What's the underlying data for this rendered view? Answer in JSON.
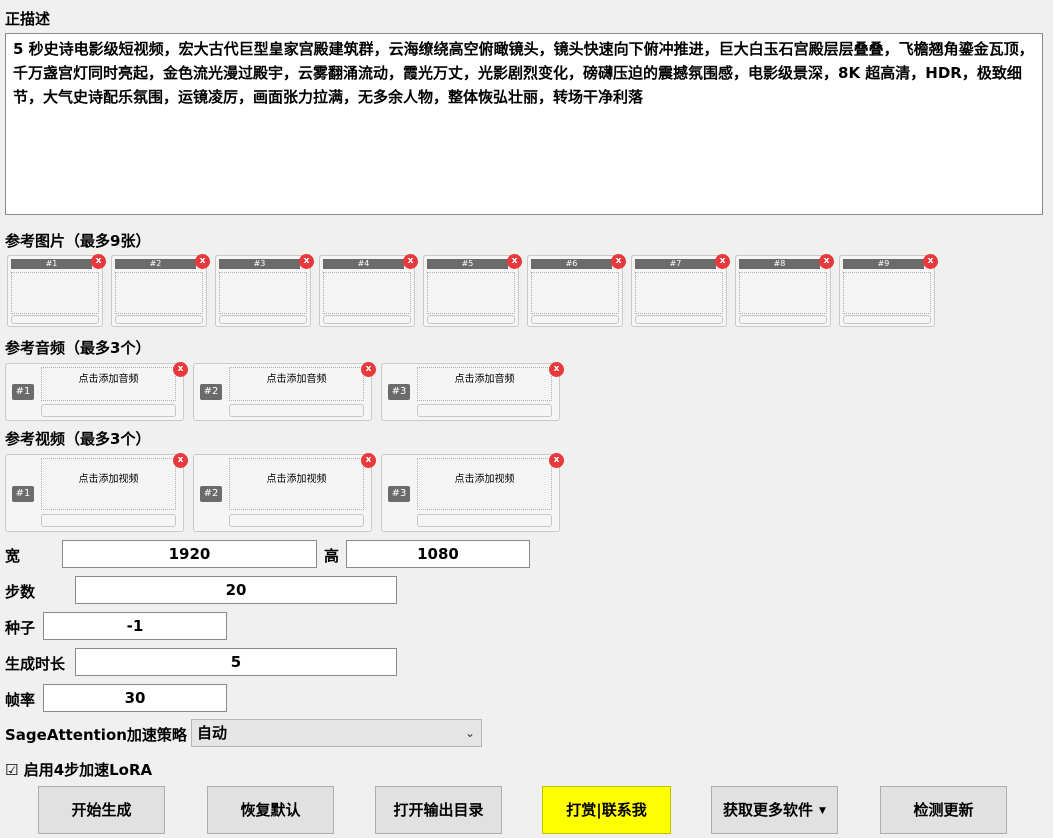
{
  "prompt": {
    "label": "正描述",
    "text": "5 秒史诗电影级短视频，宏大古代巨型皇家宫殿建筑群，云海缭绕高空俯瞰镜头，镜头快速向下俯冲推进，巨大白玉石宫殿层层叠叠，飞檐翘角鎏金瓦顶，千万盏宫灯同时亮起，金色流光漫过殿宇，云雾翻涌流动，霞光万丈，光影剧烈变化，磅礴压迫的震撼氛围感，电影级景深，8K 超高清，HDR，极致细节，大气史诗配乐氛围，运镜凌厉，画面张力拉满，无多余人物，整体恢弘壮丽，转场干净利落"
  },
  "images": {
    "label": "参考图片（最多9张）",
    "slots": [
      "#1",
      "#2",
      "#3",
      "#4",
      "#5",
      "#6",
      "#7",
      "#8",
      "#9"
    ],
    "remove_glyph": "x"
  },
  "audio": {
    "label": "参考音频（最多3个）",
    "slots": [
      {
        "index": "#1",
        "prompt": "点击添加音频"
      },
      {
        "index": "#2",
        "prompt": "点击添加音频"
      },
      {
        "index": "#3",
        "prompt": "点击添加音频"
      }
    ]
  },
  "video": {
    "label": "参考视频（最多3个）",
    "slots": [
      {
        "index": "#1",
        "prompt": "点击添加视频"
      },
      {
        "index": "#2",
        "prompt": "点击添加视频"
      },
      {
        "index": "#3",
        "prompt": "点击添加视频"
      }
    ]
  },
  "params": {
    "width_label": "宽",
    "width": "1920",
    "height_label": "高",
    "height": "1080",
    "steps_label": "步数",
    "steps": "20",
    "seed_label": "种子",
    "seed": "-1",
    "duration_label": "生成时长",
    "duration": "5",
    "fps_label": "帧率",
    "fps": "30"
  },
  "sage": {
    "label": "SageAttention加速策略",
    "selected": "自动",
    "chevron_icon": "chevron-down-icon"
  },
  "lora": {
    "checked_glyph": "☑",
    "label": "启用4步加速LoRA"
  },
  "buttons": {
    "start": "开始生成",
    "reset": "恢复默认",
    "open_output": "打开输出目录",
    "donate": "打赏|联系我",
    "more_software": "获取更多软件",
    "check_update": "检测更新"
  },
  "colors": {
    "background": "#f0f0f0",
    "remove_button": "#e8393d",
    "donate_button": "#ffff00",
    "slot_header": "#6b6b6b"
  }
}
